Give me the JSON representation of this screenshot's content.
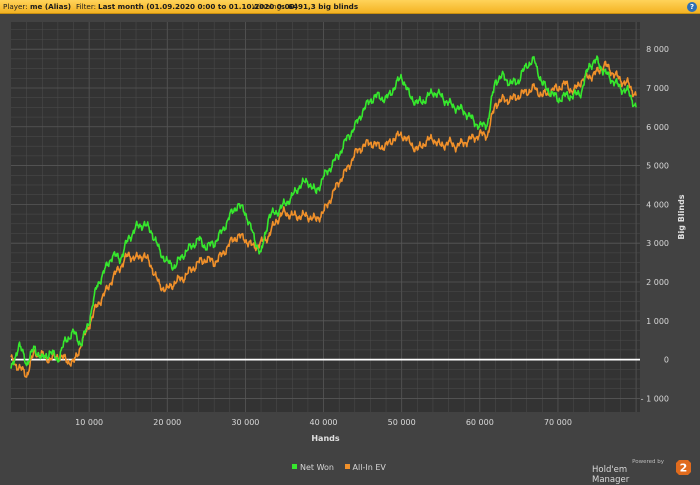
{
  "header": {
    "player_label": "Player:",
    "player_value": "me (Alias)",
    "filter_label": "Filter:",
    "filter_value": "Last month (01.09.2020 0:00 to 01.10.2020 0:00)",
    "winnings_label": "Winnings:",
    "winnings_value": "6491,3 big blinds",
    "help_icon": "help-icon",
    "help_glyph": "?"
  },
  "colors": {
    "background": "#424242",
    "plot_background": "#333333",
    "grid": "#4d4d4d",
    "net_won": "#36e82d",
    "all_in_ev": "#f0902a",
    "zero_line": "#ffffff",
    "header_bar": "#f4b323"
  },
  "chart_data": {
    "type": "line",
    "title": "",
    "xlabel": "Hands",
    "ylabel": "Big Blinds",
    "xlim": [
      0,
      80500
    ],
    "ylim": [
      -1350,
      8700
    ],
    "grid": true,
    "legend_position": "bottom-center",
    "x_ticks": [
      10000,
      20000,
      30000,
      40000,
      50000,
      60000,
      70000
    ],
    "x_tick_labels": [
      "10 000",
      "20 000",
      "30 000",
      "40 000",
      "50 000",
      "60 000",
      "70 000"
    ],
    "y_ticks": [
      -1000,
      0,
      1000,
      2000,
      3000,
      4000,
      5000,
      6000,
      7000,
      8000
    ],
    "y_tick_labels": [
      "- 1 000",
      "0",
      "1 000",
      "2 000",
      "3 000",
      "4 000",
      "5 000",
      "6 000",
      "7 000",
      "8 000"
    ],
    "series": [
      {
        "name": "Net Won",
        "color": "#36e82d",
        "x": [
          0,
          1000,
          2000,
          3000,
          4000,
          5000,
          6000,
          7000,
          8000,
          9000,
          10000,
          11000,
          12000,
          13000,
          14000,
          15000,
          16000,
          17000,
          18000,
          19000,
          20000,
          21000,
          22000,
          23000,
          24000,
          25000,
          26000,
          27000,
          28000,
          29000,
          30000,
          31000,
          32000,
          33000,
          34000,
          35000,
          36000,
          37000,
          38000,
          39000,
          40000,
          41000,
          42000,
          43000,
          44000,
          45000,
          46000,
          47000,
          48000,
          49000,
          50000,
          51000,
          52000,
          53000,
          54000,
          55000,
          56000,
          57000,
          58000,
          59000,
          60000,
          61000,
          62000,
          63000,
          64000,
          65000,
          66000,
          67000,
          68000,
          69000,
          70000,
          71000,
          72000,
          73000,
          74000,
          75000,
          76000,
          77000,
          78000,
          79000,
          80000
        ],
        "values": [
          -300,
          400,
          -100,
          300,
          0,
          200,
          0,
          500,
          700,
          400,
          1000,
          1900,
          2300,
          2700,
          2600,
          3100,
          3400,
          3500,
          3300,
          2800,
          2500,
          2400,
          2700,
          2900,
          3100,
          2900,
          3000,
          3300,
          3700,
          4000,
          3800,
          3200,
          2700,
          3700,
          3800,
          4000,
          4200,
          4500,
          4600,
          4300,
          4700,
          5000,
          5300,
          5700,
          6000,
          6400,
          6700,
          6800,
          6700,
          7000,
          7300,
          6800,
          6600,
          6700,
          6900,
          6800,
          6600,
          6500,
          6400,
          6200,
          6000,
          6100,
          7200,
          7300,
          7100,
          7200,
          7600,
          7700,
          7100,
          6900,
          6700,
          6800,
          6800,
          6900,
          7600,
          7700,
          7400,
          7200,
          7000,
          6900,
          6500
        ]
      },
      {
        "name": "All-In EV",
        "color": "#f0902a",
        "x": [
          0,
          1000,
          2000,
          3000,
          4000,
          5000,
          6000,
          7000,
          8000,
          9000,
          10000,
          11000,
          12000,
          13000,
          14000,
          15000,
          16000,
          17000,
          18000,
          19000,
          20000,
          21000,
          22000,
          23000,
          24000,
          25000,
          26000,
          27000,
          28000,
          29000,
          30000,
          31000,
          32000,
          33000,
          34000,
          35000,
          36000,
          37000,
          38000,
          39000,
          40000,
          41000,
          42000,
          43000,
          44000,
          45000,
          46000,
          47000,
          48000,
          49000,
          50000,
          51000,
          52000,
          53000,
          54000,
          55000,
          56000,
          57000,
          58000,
          59000,
          60000,
          61000,
          62000,
          63000,
          64000,
          65000,
          66000,
          67000,
          68000,
          69000,
          70000,
          71000,
          72000,
          73000,
          74000,
          75000,
          76000,
          77000,
          78000,
          79000,
          80000
        ],
        "values": [
          0,
          -200,
          -400,
          200,
          100,
          0,
          100,
          0,
          -100,
          400,
          900,
          1400,
          1700,
          2100,
          2400,
          2700,
          2600,
          2700,
          2400,
          1900,
          1800,
          2000,
          2100,
          2300,
          2500,
          2600,
          2500,
          2700,
          3000,
          3200,
          3100,
          2900,
          3000,
          3200,
          3600,
          3800,
          3700,
          3700,
          3700,
          3600,
          3800,
          4200,
          4600,
          4900,
          5300,
          5500,
          5600,
          5500,
          5500,
          5700,
          5800,
          5600,
          5400,
          5600,
          5700,
          5500,
          5600,
          5500,
          5600,
          5700,
          5800,
          5800,
          6600,
          6700,
          6700,
          6800,
          6900,
          7000,
          6800,
          6900,
          7000,
          7100,
          6900,
          7200,
          7300,
          7400,
          7600,
          7400,
          7200,
          7100,
          6800
        ]
      }
    ]
  },
  "legend": {
    "net_won": "Net Won",
    "all_in_ev": "All-In EV"
  },
  "branding": {
    "powered_by": "Powered by",
    "product": "Hold'em Manager",
    "logo_number": "2"
  }
}
